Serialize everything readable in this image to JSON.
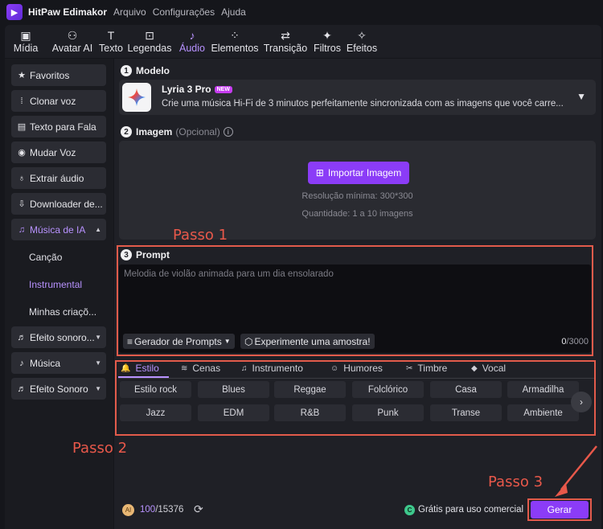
{
  "app": {
    "title": "HitPaw Edimakor"
  },
  "menu": [
    "Arquivo",
    "Configurações",
    "Ajuda"
  ],
  "toolbar": [
    {
      "label": "Mídia",
      "icon": "media-icon"
    },
    {
      "label": "Avatar AI",
      "icon": "avatar-icon"
    },
    {
      "label": "Texto",
      "icon": "text-icon"
    },
    {
      "label": "Legendas",
      "icon": "subtitles-icon"
    },
    {
      "label": "Áudio",
      "icon": "audio-icon",
      "active": true
    },
    {
      "label": "Elementos",
      "icon": "elements-icon"
    },
    {
      "label": "Transição",
      "icon": "transition-icon"
    },
    {
      "label": "Filtros",
      "icon": "filters-icon"
    },
    {
      "label": "Efeitos",
      "icon": "effects-icon"
    }
  ],
  "sidebar": {
    "items": [
      {
        "label": "Favoritos",
        "icon": "star-icon"
      },
      {
        "label": "Clonar voz",
        "icon": "voice-clone-icon"
      },
      {
        "label": "Texto para Fala",
        "icon": "text-to-speech-icon"
      },
      {
        "label": "Mudar Voz",
        "icon": "change-voice-icon"
      },
      {
        "label": "Extrair áudio",
        "icon": "microphone-icon"
      },
      {
        "label": "Downloader de...",
        "icon": "download-icon"
      },
      {
        "label": "Música de IA",
        "icon": "ai-music-icon",
        "active": true
      },
      {
        "label": "Efeito sonoro...",
        "icon": "sound-effect-icon"
      },
      {
        "label": "Música",
        "icon": "music-note-icon"
      },
      {
        "label": "Efeito Sonoro",
        "icon": "sound-effect-icon"
      }
    ],
    "subitems": [
      {
        "label": "Canção"
      },
      {
        "label": "Instrumental",
        "active": true
      },
      {
        "label": "Minhas criaçõ..."
      }
    ]
  },
  "model": {
    "step": "1",
    "title": "Modelo",
    "name": "Lyria 3 Pro",
    "badge": "NEW",
    "description": "Crie uma música Hi-Fi de 3 minutos perfeitamente sincronizada com as imagens que você carre..."
  },
  "image": {
    "step": "2",
    "title": "Imagem",
    "optional": "(Opcional)",
    "import_label": "Importar Imagem",
    "resolution": "Resolução mínima: 300*300",
    "quantity": "Quantidade: 1 a 10 imagens"
  },
  "prompt": {
    "step": "3",
    "title": "Prompt",
    "placeholder": "Melodia de violão animada para um dia ensolarado",
    "generator_label": "Gerador de Prompts",
    "sample_label": "Experimente uma amostra!",
    "count_current": "0",
    "count_max": "/3000"
  },
  "tabs": [
    {
      "label": "Estilo",
      "icon": "style-icon",
      "active": true
    },
    {
      "label": "Cenas",
      "icon": "scenes-icon"
    },
    {
      "label": "Instrumento",
      "icon": "instrument-icon"
    },
    {
      "label": "Humores",
      "icon": "mood-icon"
    },
    {
      "label": "Timbre",
      "icon": "timbre-icon"
    },
    {
      "label": "Vocal",
      "icon": "vocal-icon"
    }
  ],
  "chips": [
    [
      "Estilo rock",
      "Blues",
      "Reggae",
      "Folclórico",
      "Casa",
      "Armadilha"
    ],
    [
      "Jazz",
      "EDM",
      "R&B",
      "Punk",
      "Transe",
      "Ambiente"
    ]
  ],
  "footer": {
    "credits_current": "100",
    "credits_total": "/15376",
    "free_label": "Grátis para uso comercial",
    "generate_label": "Gerar"
  },
  "annotations": {
    "step1": "Passo 1",
    "step2": "Passo 2",
    "step3": "Passo 3",
    "color": "#e8584a"
  }
}
